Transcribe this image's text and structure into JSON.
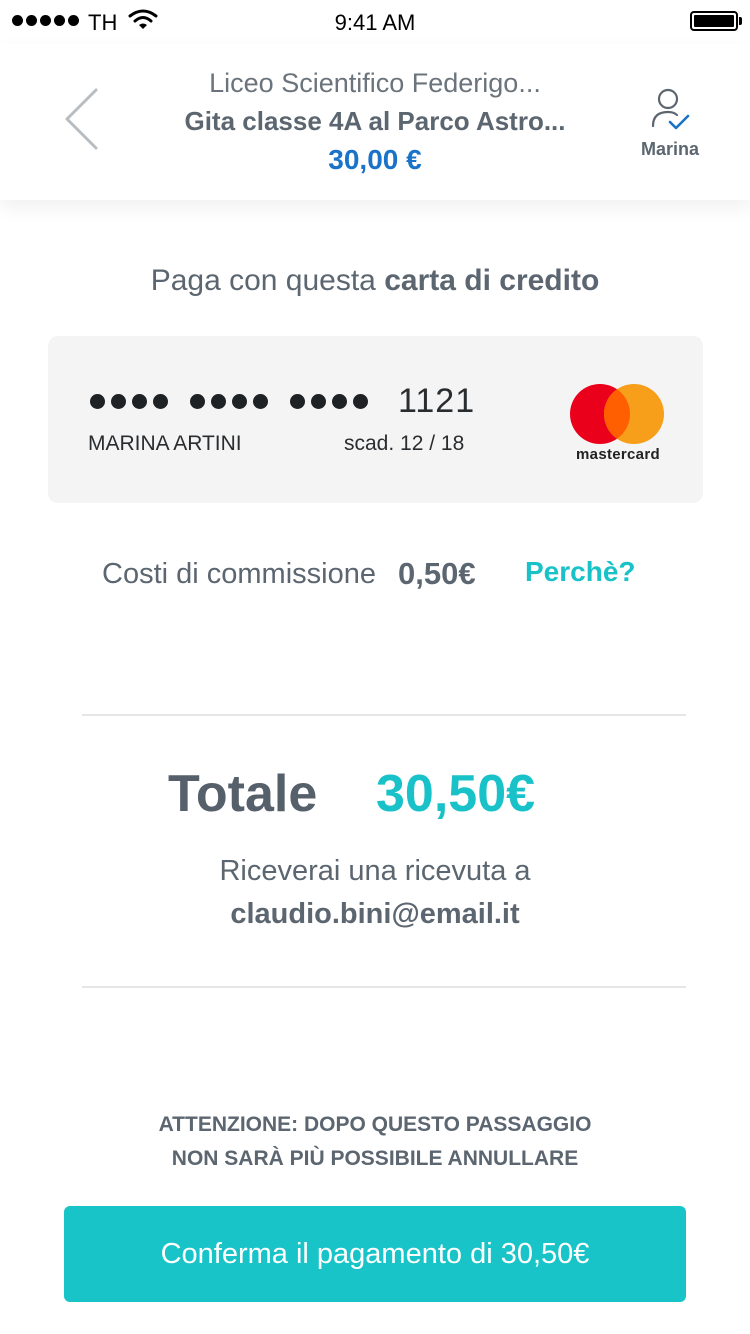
{
  "status_bar": {
    "carrier": "TH",
    "time": "9:41 AM"
  },
  "header": {
    "school": "Liceo Scientifico Federigo...",
    "trip": "Gita classe 4A al Parco Astro...",
    "amount": "30,00 €",
    "user_name": "Marina"
  },
  "payment": {
    "pay_with_prefix": "Paga con questa",
    "pay_with_bold": "carta di credito"
  },
  "card": {
    "masked_groups": 3,
    "last4": "1121",
    "holder": "MARINA ARTINI",
    "expiry": "scad. 12 / 18",
    "brand": "mastercard"
  },
  "fees": {
    "label": "Costi di commissione",
    "value": "0,50€",
    "why_link": "Perchè?"
  },
  "total": {
    "label": "Totale",
    "value": "30,50€",
    "receipt_text": "Riceverai una ricevuta a",
    "receipt_email": "claudio.bini@email.it"
  },
  "warning": {
    "line1": "ATTENZIONE: DOPO QUESTO PASSAGGIO",
    "line2": "NON SARÀ PIÙ POSSIBILE ANNULLARE"
  },
  "confirm_button": "Conferma il pagamento di 30,50€",
  "colors": {
    "accent": "#19c2c8",
    "amount_blue": "#1a73c8",
    "text": "#5c6670",
    "card_bg": "#f4f4f4"
  },
  "icons": {
    "back": "chevron-left-icon",
    "user": "user-check-icon",
    "signal": "signal-icon",
    "wifi": "wifi-icon",
    "battery": "battery-icon"
  }
}
